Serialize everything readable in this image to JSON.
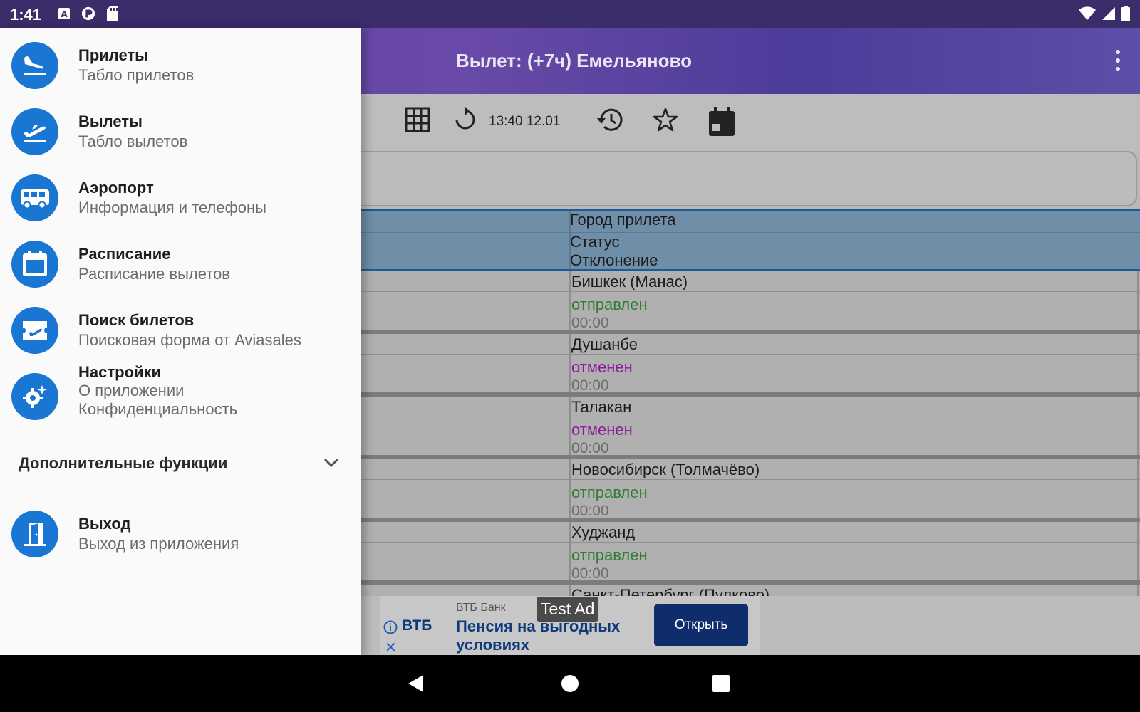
{
  "status_bar": {
    "time": "1:41",
    "icons": [
      "a-icon",
      "p-icon",
      "sd-card-icon"
    ],
    "right_icons": [
      "wifi-icon",
      "signal-icon",
      "battery-icon"
    ]
  },
  "app": {
    "title": "Вылет: (+7ч) Емельяново",
    "toolbar": {
      "time": "13:40 12.01"
    },
    "table": {
      "header": {
        "col2_line1": "Город прилета",
        "col2_line2": "Статус",
        "col2_line3": "Отклонение"
      },
      "rows": [
        {
          "city": "Бишкек (Манас)",
          "status": "отправлен",
          "status_color": "#2e7d32",
          "deviation": "00:00"
        },
        {
          "city": "Душанбе",
          "status": "отменен",
          "status_color": "#8e1b9c",
          "deviation": "00:00"
        },
        {
          "city": "Талакан",
          "status": "отменен",
          "status_color": "#8e1b9c",
          "deviation": "00:00"
        },
        {
          "city": "Новосибирск (Толмачёво)",
          "status": "отправлен",
          "status_color": "#2e7d32",
          "deviation": "00:00"
        },
        {
          "city": "Худжанд",
          "status": "отправлен",
          "status_color": "#2e7d32",
          "deviation": "00:00"
        },
        {
          "city": "Санкт-Петербург (Пулково)"
        }
      ]
    }
  },
  "ad": {
    "badge": "Test Ad",
    "advertiser": "ВТБ Банк",
    "logo": "ВТБ",
    "headline": "Пенсия на выгодных условиях",
    "button": "Открыть"
  },
  "drawer": {
    "items": [
      {
        "title": "Прилеты",
        "subtitle": "Табло прилетов",
        "icon": "plane-landing-icon"
      },
      {
        "title": "Вылеты",
        "subtitle": "Табло вылетов",
        "icon": "plane-takeoff-icon"
      },
      {
        "title": "Аэропорт",
        "subtitle": "Информация и телефоны",
        "icon": "bus-icon"
      },
      {
        "title": "Расписание",
        "subtitle": "Расписание вылетов",
        "icon": "calendar-icon"
      },
      {
        "title": "Поиск билетов",
        "subtitle": "Поисковая форма от Aviasales",
        "icon": "ticket-icon"
      },
      {
        "title": "Настройки",
        "subtitle": "О приложении",
        "subtitle2": "Конфиденциальность",
        "icon": "settings-icon"
      }
    ],
    "section": "Дополнительные функции",
    "exit": {
      "title": "Выход",
      "subtitle": "Выход из приложения",
      "icon": "exit-door-icon"
    }
  },
  "colors": {
    "accent": "#1976d2",
    "appbar": "#5a3d9e",
    "header_row": "#6f8ea7",
    "status_ok": "#2e7d32",
    "status_cancel": "#8e1b9c"
  }
}
